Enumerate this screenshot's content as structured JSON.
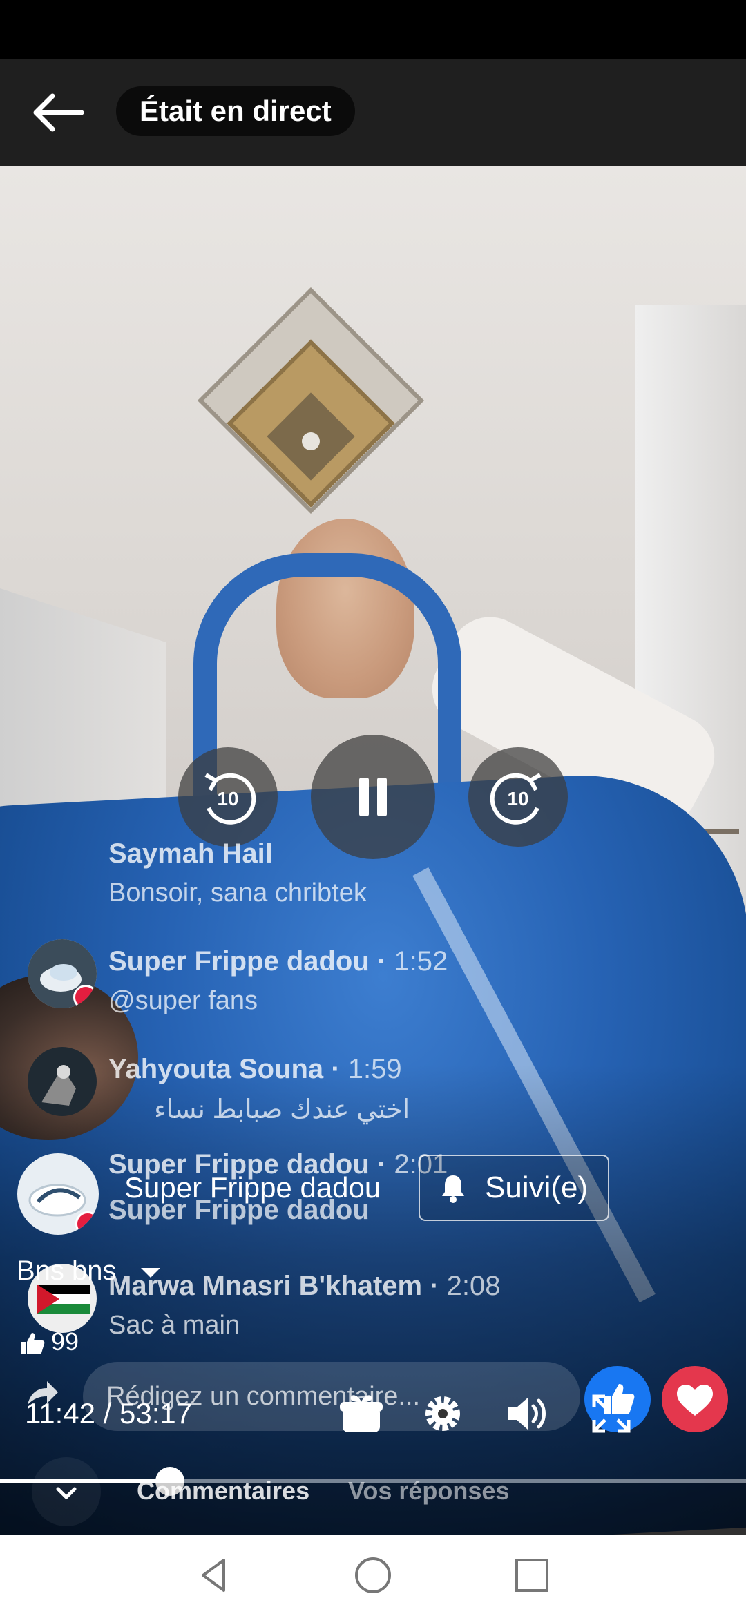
{
  "header": {
    "live_label": "Était en direct"
  },
  "comments": [
    {
      "author": "Saymah Hail",
      "time": "",
      "text": "Bonsoir, sana chribtek"
    },
    {
      "author": "Super Frippe dadou",
      "time": "1:52",
      "text": "@super fans"
    },
    {
      "author": "Yahyouta Souna",
      "time": "1:59",
      "text": "اختي عندك صبابط نساء"
    },
    {
      "author": "Super Frippe dadou",
      "time": "2:01",
      "text": "Super Frippe dadou"
    },
    {
      "author": "Marwa Mnasri B'khatem",
      "time": "2:08",
      "text": "Sac à main"
    }
  ],
  "channel": {
    "name": "Super Frippe dadou",
    "follow_label": "Suivi(e)"
  },
  "sort": {
    "label": "Bns bns"
  },
  "reactions": {
    "count": "99"
  },
  "comment_input": {
    "placeholder": "Rédigez un commentaire..."
  },
  "player": {
    "time": "11:42 / 53:17",
    "rewind_seconds": "10",
    "forward_seconds": "10",
    "progress": 0.22
  },
  "tabs": [
    {
      "label": "Commentaires",
      "active": true
    },
    {
      "label": "Vos réponses",
      "active": false
    }
  ],
  "colors": {
    "like": "#1877f2",
    "love": "#e4374d",
    "live_badge": "#e41e3f"
  },
  "icons": {
    "back": "back-arrow-icon",
    "rewind": "rewind-10-icon",
    "pause": "pause-icon",
    "forward": "forward-10-icon",
    "bell": "bell-icon",
    "gift": "gift-icon",
    "settings": "gear-icon",
    "volume": "volume-icon",
    "fullscreen": "fullscreen-icon"
  }
}
